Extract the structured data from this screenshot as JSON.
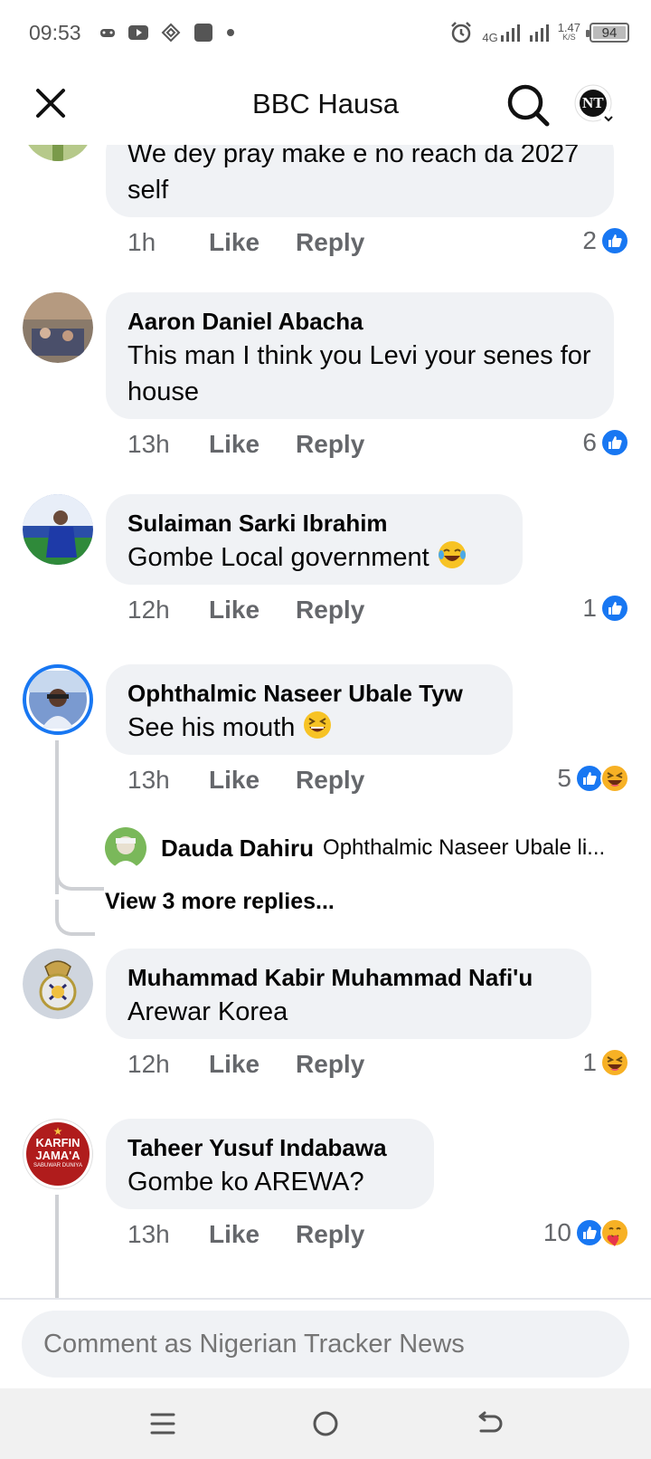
{
  "status_bar": {
    "time": "09:53",
    "network": "4G",
    "speed_value": "1.47",
    "speed_unit": "K/S",
    "battery": "94",
    "icons": [
      "gamepad-icon",
      "youtube-icon",
      "vpn-icon",
      "app-icon",
      "dot-icon",
      "alarm-icon",
      "signal-icon",
      "signal-icon"
    ]
  },
  "header": {
    "title": "BBC Hausa",
    "close_icon": "close-icon",
    "search_icon": "search-icon",
    "profile_initials": "NT"
  },
  "comments": [
    {
      "author": "",
      "text": "We dey pray make e no reach da 2027 self",
      "time": "1h",
      "like_label": "Like",
      "reply_label": "Reply",
      "reaction_count": "2",
      "reactions": [
        "like"
      ]
    },
    {
      "author": "Aaron Daniel Abacha",
      "text": "This man I think you Levi your senes for house",
      "time": "13h",
      "like_label": "Like",
      "reply_label": "Reply",
      "reaction_count": "6",
      "reactions": [
        "like"
      ]
    },
    {
      "author": "Sulaiman Sarki Ibrahim",
      "text": "Gombe Local government",
      "emoji": "laughing-tears-emoji",
      "time": "12h",
      "like_label": "Like",
      "reply_label": "Reply",
      "reaction_count": "1",
      "reactions": [
        "like"
      ]
    },
    {
      "author": "Ophthalmic Naseer Ubale Tyw",
      "text": "See his mouth",
      "emoji": "grinning-squint-emoji",
      "time": "13h",
      "like_label": "Like",
      "reply_label": "Reply",
      "reaction_count": "5",
      "reactions": [
        "like",
        "haha"
      ],
      "reply_preview": {
        "author": "Dauda Dahiru",
        "text": "Ophthalmic Naseer Ubale li..."
      },
      "view_more": "View 3 more replies..."
    },
    {
      "author": "Muhammad Kabir Muhammad Nafi'u",
      "text": "Arewar Korea",
      "time": "12h",
      "like_label": "Like",
      "reply_label": "Reply",
      "reaction_count": "1",
      "reactions": [
        "haha"
      ]
    },
    {
      "author": "Taheer Yusuf Indabawa",
      "text": "Gombe ko AREWA?",
      "time": "13h",
      "like_label": "Like",
      "reply_label": "Reply",
      "reaction_count": "10",
      "reactions": [
        "like",
        "care"
      ],
      "avatar_text": [
        "KARFIN",
        "JAMA'A",
        "SABUWAR DUNIYA"
      ]
    }
  ],
  "composer": {
    "placeholder": "Comment as Nigerian Tracker News"
  },
  "nav": {
    "menu_icon": "menu-icon",
    "home_icon": "home-icon",
    "back_icon": "back-icon"
  },
  "colors": {
    "bubble": "#f0f2f5",
    "like_blue": "#1877f2",
    "meta_gray": "#65676b",
    "reaction_yellow": "#f7b125"
  }
}
